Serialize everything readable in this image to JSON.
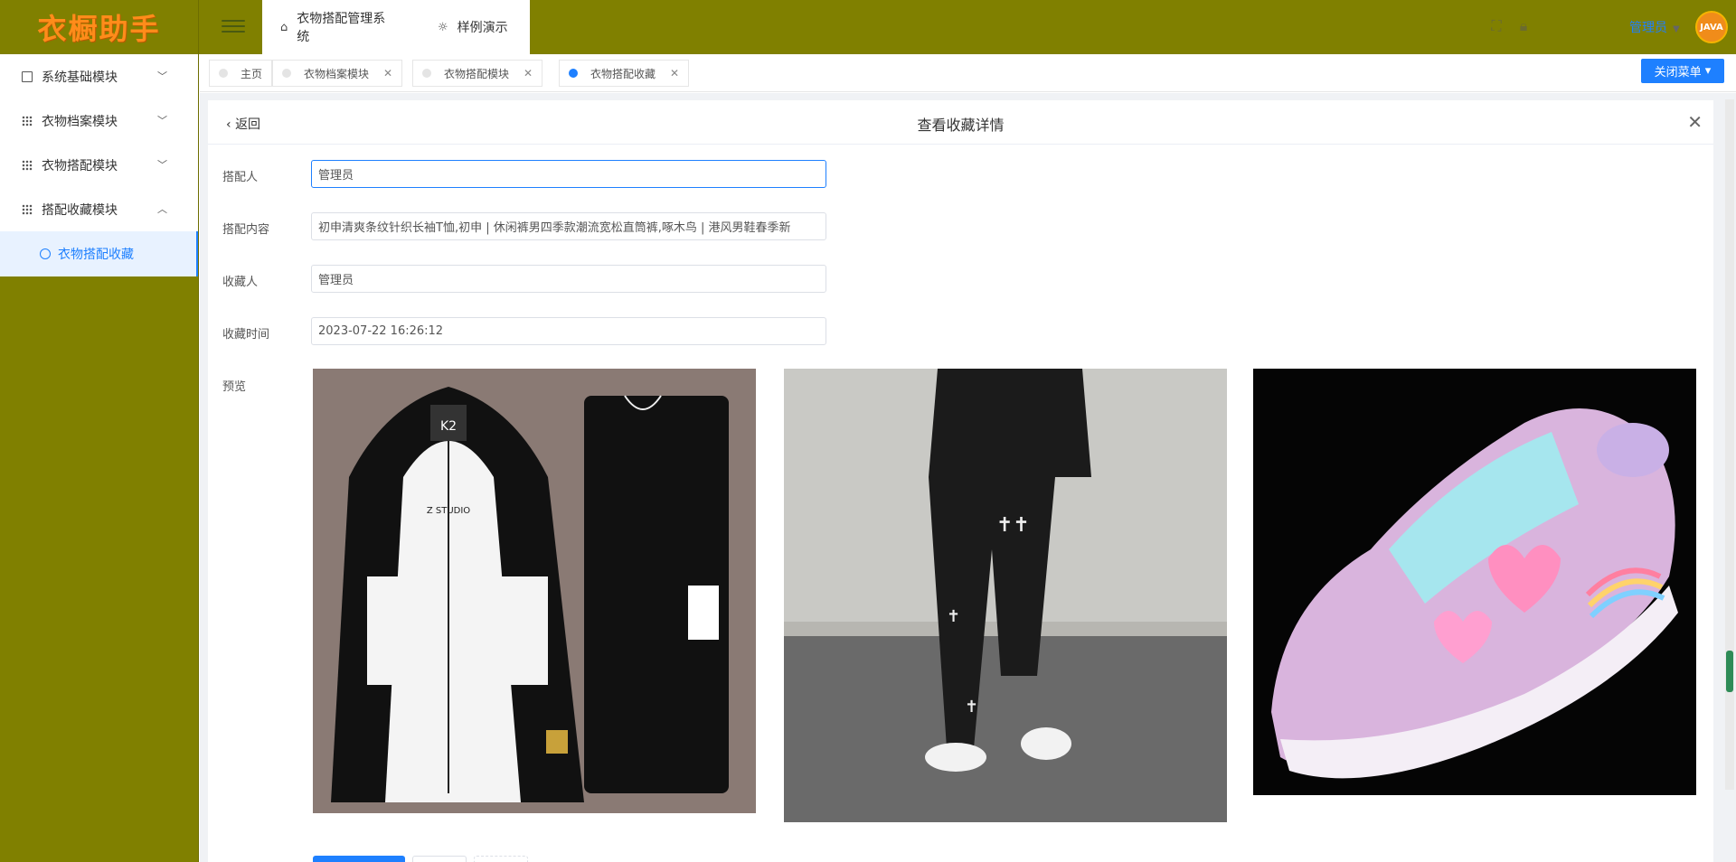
{
  "app": {
    "logo_text": "衣橱助手",
    "top_tabs": [
      {
        "label": "衣物搭配管理系统",
        "icon": "home-icon"
      },
      {
        "label": "样例演示",
        "icon": "sun-icon"
      }
    ],
    "user_name": "管理员",
    "avatar_text": "JAVA"
  },
  "sidebar": {
    "items": [
      {
        "label": "系统基础模块",
        "icon": "chart-icon",
        "expanded": false
      },
      {
        "label": "衣物档案模块",
        "icon": "grid-icon",
        "expanded": false
      },
      {
        "label": "衣物搭配模块",
        "icon": "grid-icon",
        "expanded": false
      },
      {
        "label": "搭配收藏模块",
        "icon": "grid-icon",
        "expanded": true
      }
    ],
    "subitem": {
      "label": "衣物搭配收藏",
      "icon": "gear-icon"
    }
  },
  "tabs": [
    {
      "label": "主页",
      "closable": false,
      "active": false
    },
    {
      "label": "衣物档案模块",
      "closable": true,
      "active": false
    },
    {
      "label": "衣物搭配模块",
      "closable": true,
      "active": false
    },
    {
      "label": "衣物搭配收藏",
      "closable": true,
      "active": true
    }
  ],
  "close_menu_label": "关闭菜单",
  "detail": {
    "back_label": "返回",
    "title": "查看收藏详情",
    "fields": [
      {
        "label": "搭配人",
        "value": "管理员"
      },
      {
        "label": "搭配内容",
        "value": "初申清爽条纹针织长袖T恤,初申 | 休闲裤男四季款潮流宽松直筒裤,啄木鸟 | 港风男鞋春季新"
      },
      {
        "label": "收藏人",
        "value": "管理员"
      },
      {
        "label": "收藏时间",
        "value": "2023-07-22 16:26:12"
      }
    ],
    "preview_label": "预览",
    "colors": {
      "accent": "#1e80ff",
      "header_bg": "#808000",
      "logo": "#ff8c1a"
    }
  }
}
